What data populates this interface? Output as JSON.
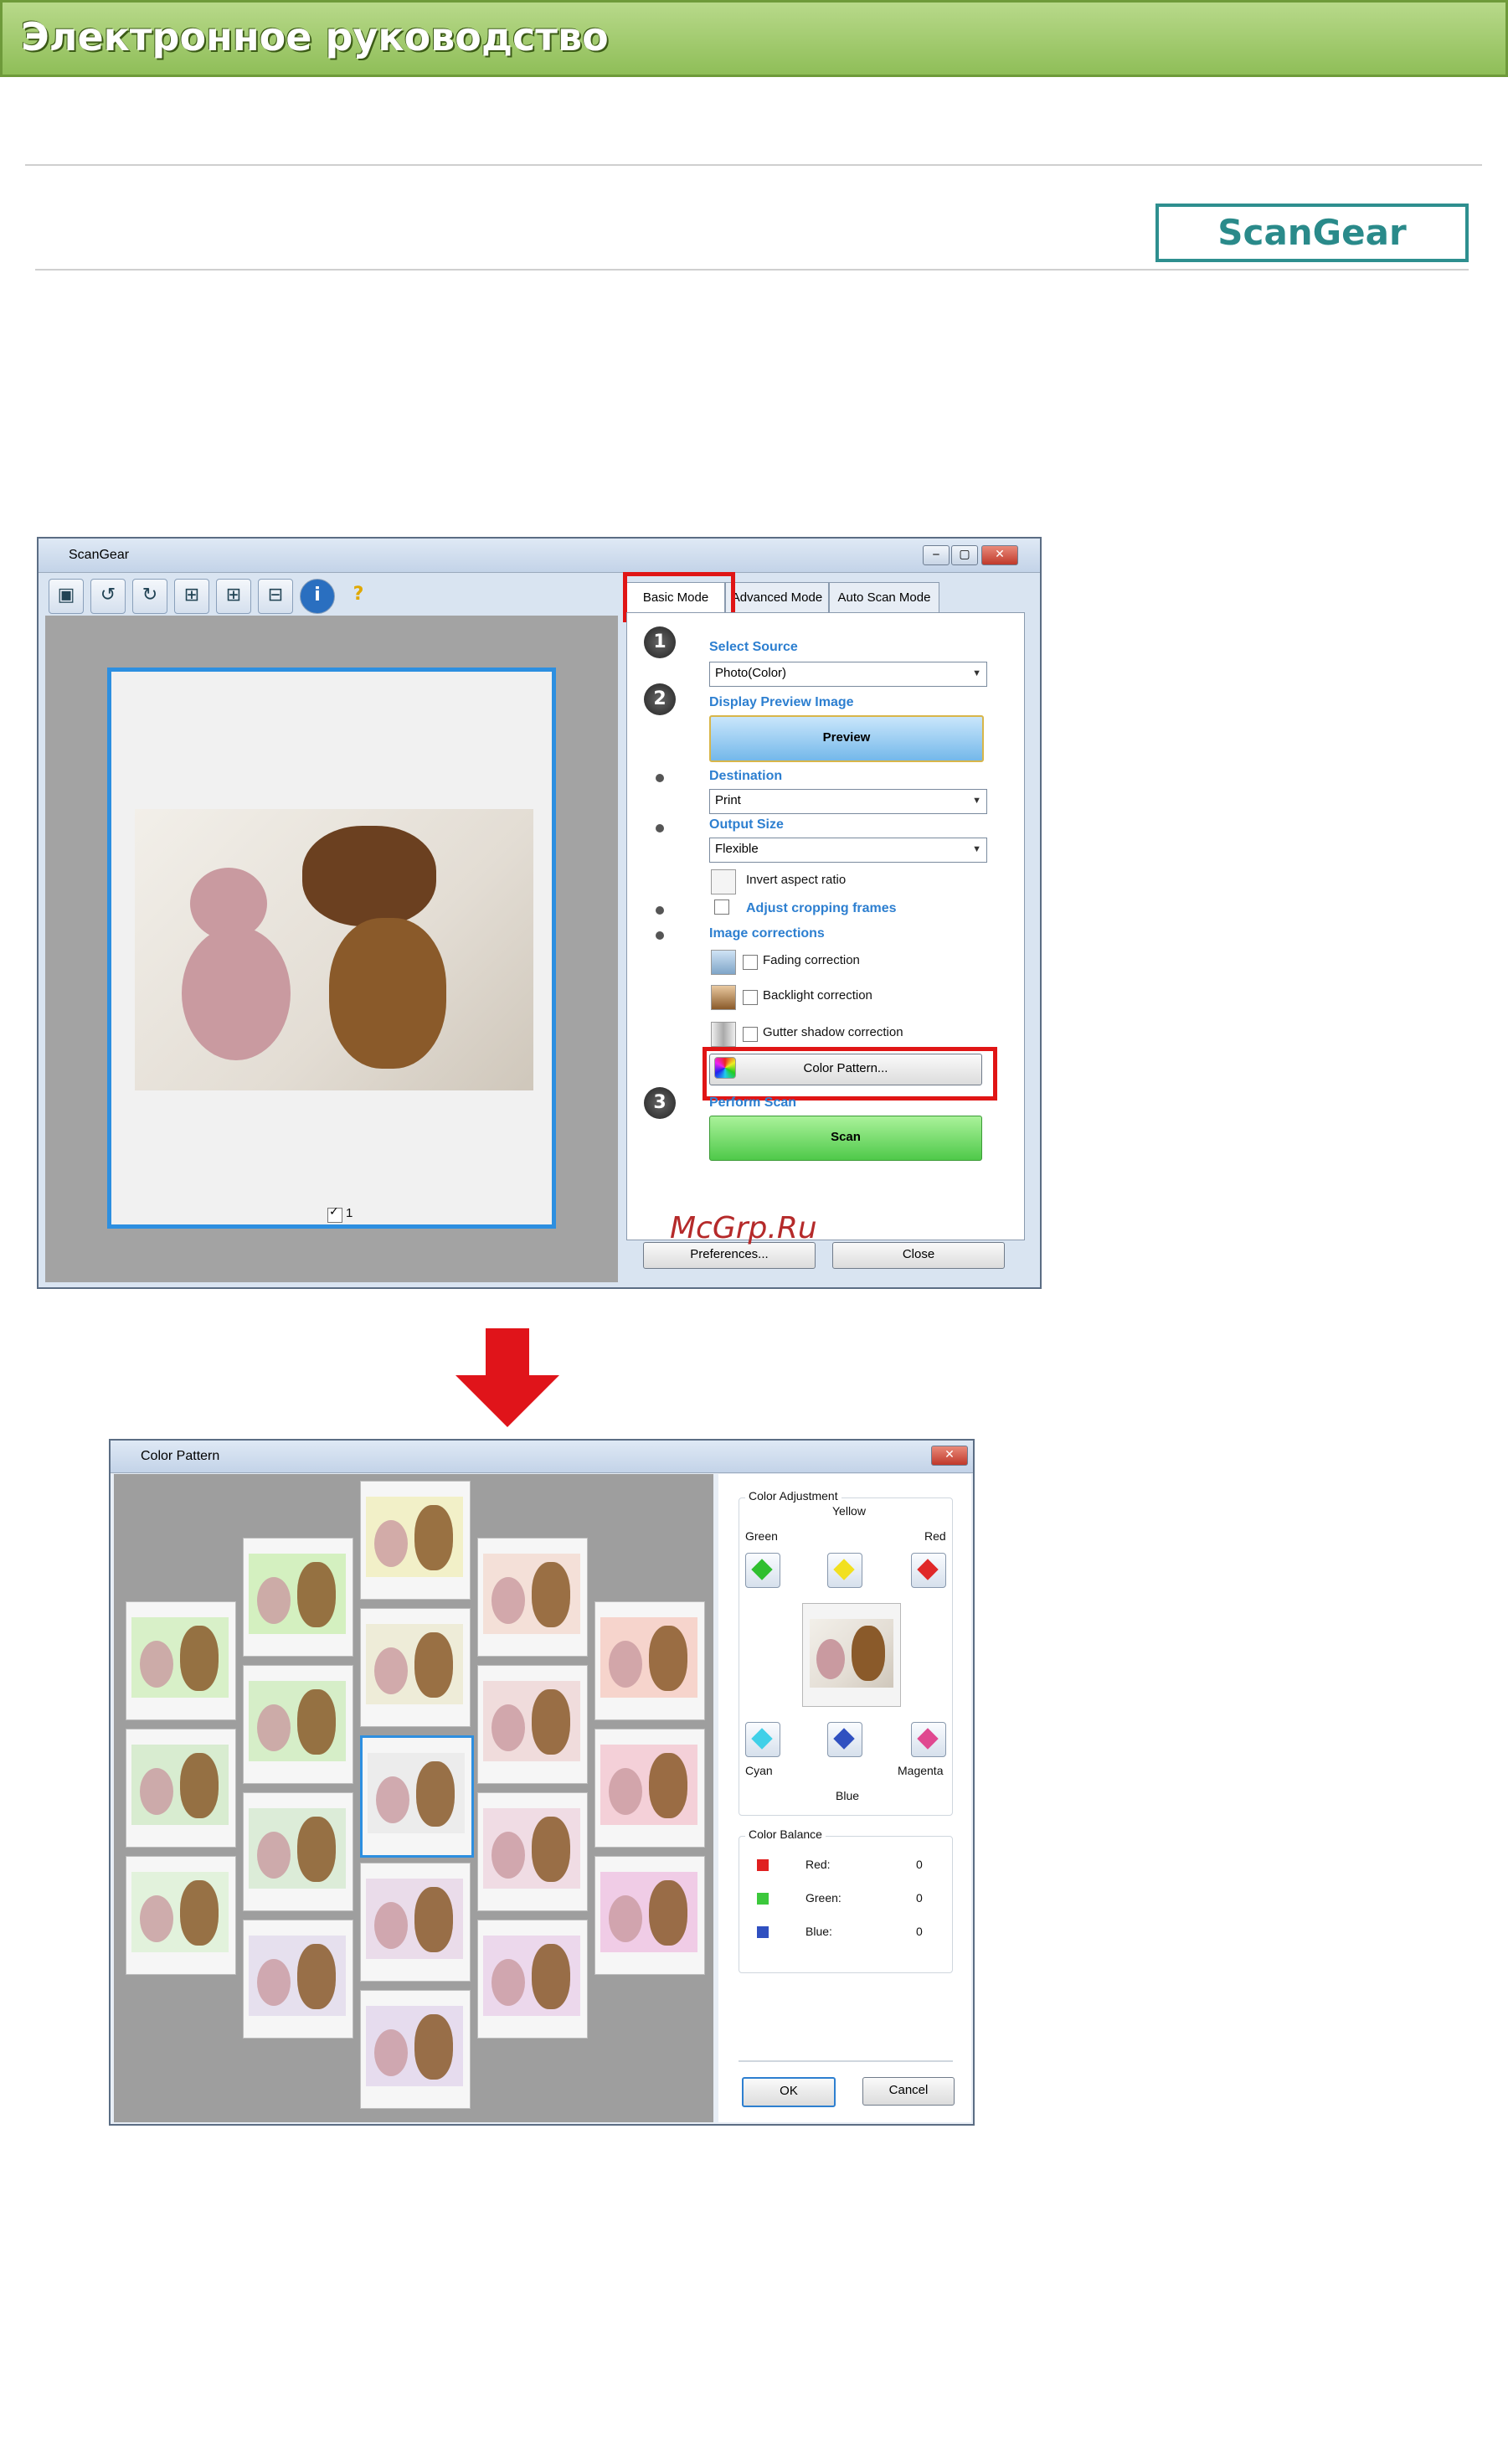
{
  "banner": {
    "title": "Электронное руководство"
  },
  "badge": {
    "label": "ScanGear"
  },
  "scangear": {
    "title": "ScanGear",
    "tabs": [
      "Basic Mode",
      "Advanced Mode",
      "Auto Scan Mode"
    ],
    "steps": [
      "1",
      "2",
      "3"
    ],
    "select_source": {
      "label": "Select Source",
      "value": "Photo(Color)"
    },
    "display_preview": {
      "label": "Display Preview Image",
      "button": "Preview"
    },
    "destination": {
      "label": "Destination",
      "value": "Print"
    },
    "output_size": {
      "label": "Output Size",
      "value": "Flexible"
    },
    "invert_aspect": "Invert aspect ratio",
    "adjust_cropping": "Adjust cropping frames",
    "image_corrections": {
      "label": "Image corrections",
      "fading": "Fading correction",
      "backlight": "Backlight correction",
      "gutter": "Gutter shadow correction"
    },
    "color_pattern_button": "Color Pattern...",
    "perform_scan": {
      "label": "Perform Scan",
      "button": "Scan"
    },
    "preferences_button": "Preferences...",
    "close_button": "Close",
    "frame_number": "1"
  },
  "watermark": "McGrp.Ru",
  "color_pattern": {
    "title": "Color Pattern",
    "color_adjustment": {
      "label": "Color Adjustment",
      "yellow": "Yellow",
      "green": "Green",
      "red": "Red",
      "cyan": "Cyan",
      "magenta": "Magenta",
      "blue": "Blue"
    },
    "color_balance": {
      "label": "Color Balance",
      "rows": [
        {
          "name": "Red:",
          "value": "0",
          "color": "#e02020"
        },
        {
          "name": "Green:",
          "value": "0",
          "color": "#3cc83c"
        },
        {
          "name": "Blue:",
          "value": "0",
          "color": "#3050c0"
        }
      ]
    },
    "ok_button": "OK",
    "cancel_button": "Cancel"
  },
  "colors": {
    "accent_red": "#e01515",
    "badge_teal": "#2e8f8f",
    "section_blue": "#2d7fd0"
  }
}
